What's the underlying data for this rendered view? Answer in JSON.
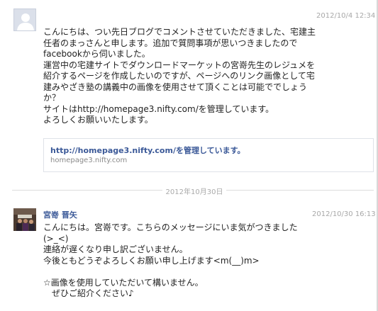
{
  "messages": [
    {
      "timestamp": "2012/10/4 12:34",
      "lines": [
        "こんにちは、つい先日ブログでコメントさせていただきました、宅建主",
        "任者のまっさんと申します。追加で質問事項が思いつきましたので",
        "facebookから伺いました。",
        "運営中の宅建サイトでダウンロードマーケットの宮嵜先生のレジュメを",
        "紹介するページを作成したいのですが、ページへのリンク画像として宅",
        "建みやざき塾の講義中の画像を使用させて頂くことは可能ででしょう",
        "か？",
        "サイトはhttp://homepage3.nifty.com/を管理しています。",
        "よろしくお願いいたします。"
      ],
      "link_preview": {
        "title": "http://homepage3.nifty.com/を管理しています。",
        "domain": "homepage3.nifty.com"
      }
    },
    {
      "sender": "宮嵜 晋矢",
      "timestamp": "2012/10/30 16:13",
      "lines": [
        "こんにちは。宮嵜です。こちらのメッセージにいま気がつきました",
        "(>_<)",
        "連絡が遅くなり申し訳ございません。",
        "今後ともどうぞよろしくお願い申し上げます<m(__)m>",
        "",
        "☆画像を使用していただいて構いません。",
        "　ぜひご紹介ください♪"
      ]
    }
  ],
  "date_divider": "2012年10月30日",
  "colors": {
    "link": "#3b5998",
    "timestamp": "#a8a8a8",
    "body": "#222222"
  }
}
